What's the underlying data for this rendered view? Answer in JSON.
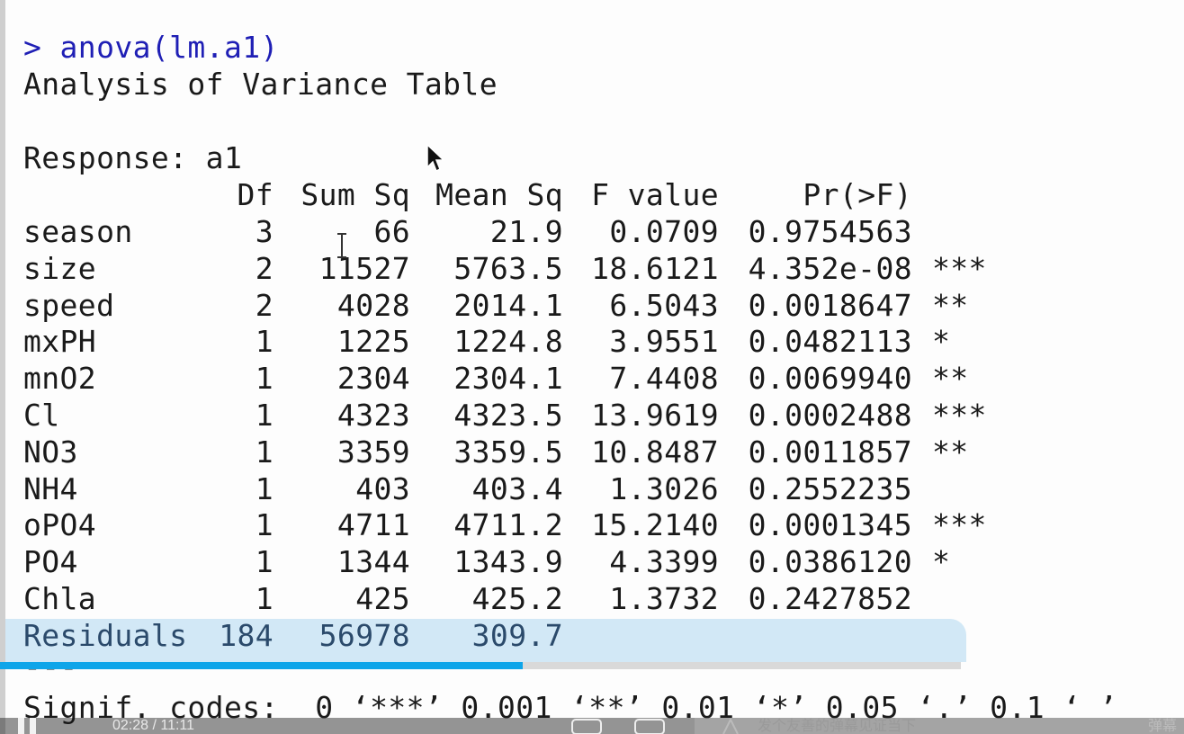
{
  "console": {
    "command": "> anova(lm.a1)",
    "title": "Analysis of Variance Table",
    "response": "Response: a1",
    "headers": [
      "Df",
      "Sum Sq",
      "Mean Sq",
      "F value",
      "Pr(>F)"
    ],
    "rows": [
      {
        "term": "season",
        "df": "3",
        "sumsq": "66",
        "meansq": "21.9",
        "f": "0.0709",
        "p": "0.9754563",
        "sig": ""
      },
      {
        "term": "size",
        "df": "2",
        "sumsq": "11527",
        "meansq": "5763.5",
        "f": "18.6121",
        "p": "4.352e-08",
        "sig": "***"
      },
      {
        "term": "speed",
        "df": "2",
        "sumsq": "4028",
        "meansq": "2014.1",
        "f": "6.5043",
        "p": "0.0018647",
        "sig": "**"
      },
      {
        "term": "mxPH",
        "df": "1",
        "sumsq": "1225",
        "meansq": "1224.8",
        "f": "3.9551",
        "p": "0.0482113",
        "sig": "*"
      },
      {
        "term": "mnO2",
        "df": "1",
        "sumsq": "2304",
        "meansq": "2304.1",
        "f": "7.4408",
        "p": "0.0069940",
        "sig": "**"
      },
      {
        "term": "Cl",
        "df": "1",
        "sumsq": "4323",
        "meansq": "4323.5",
        "f": "13.9619",
        "p": "0.0002488",
        "sig": "***"
      },
      {
        "term": "NO3",
        "df": "1",
        "sumsq": "3359",
        "meansq": "3359.5",
        "f": "10.8487",
        "p": "0.0011857",
        "sig": "**"
      },
      {
        "term": "NH4",
        "df": "1",
        "sumsq": "403",
        "meansq": "403.4",
        "f": "1.3026",
        "p": "0.2552235",
        "sig": ""
      },
      {
        "term": "oPO4",
        "df": "1",
        "sumsq": "4711",
        "meansq": "4711.2",
        "f": "15.2140",
        "p": "0.0001345",
        "sig": "***"
      },
      {
        "term": "PO4",
        "df": "1",
        "sumsq": "1344",
        "meansq": "1343.9",
        "f": "4.3399",
        "p": "0.0386120",
        "sig": "*"
      },
      {
        "term": "Chla",
        "df": "1",
        "sumsq": "425",
        "meansq": "425.2",
        "f": "1.3732",
        "p": "0.2427852",
        "sig": ""
      },
      {
        "term": "Residuals",
        "df": "184",
        "sumsq": "56978",
        "meansq": "309.7",
        "f": "",
        "p": "",
        "sig": ""
      }
    ],
    "separator": "---",
    "signif": "Signif. codes:  0 ‘***’ 0.001 ‘**’ 0.01 ‘*’ 0.05 ‘.’ 0.1 ‘ ’"
  },
  "player": {
    "progress_fraction": 0.544,
    "time": "02:28 / 11:11",
    "danmu_placeholder": "发个友善的弹幕见证当下",
    "send_label": "弹幕",
    "accent_color": "#0ea5e9",
    "icons": [
      "pause-icon",
      "danmu-toggle-icon",
      "danmu-settings-icon",
      "danmu-style-icon"
    ]
  }
}
